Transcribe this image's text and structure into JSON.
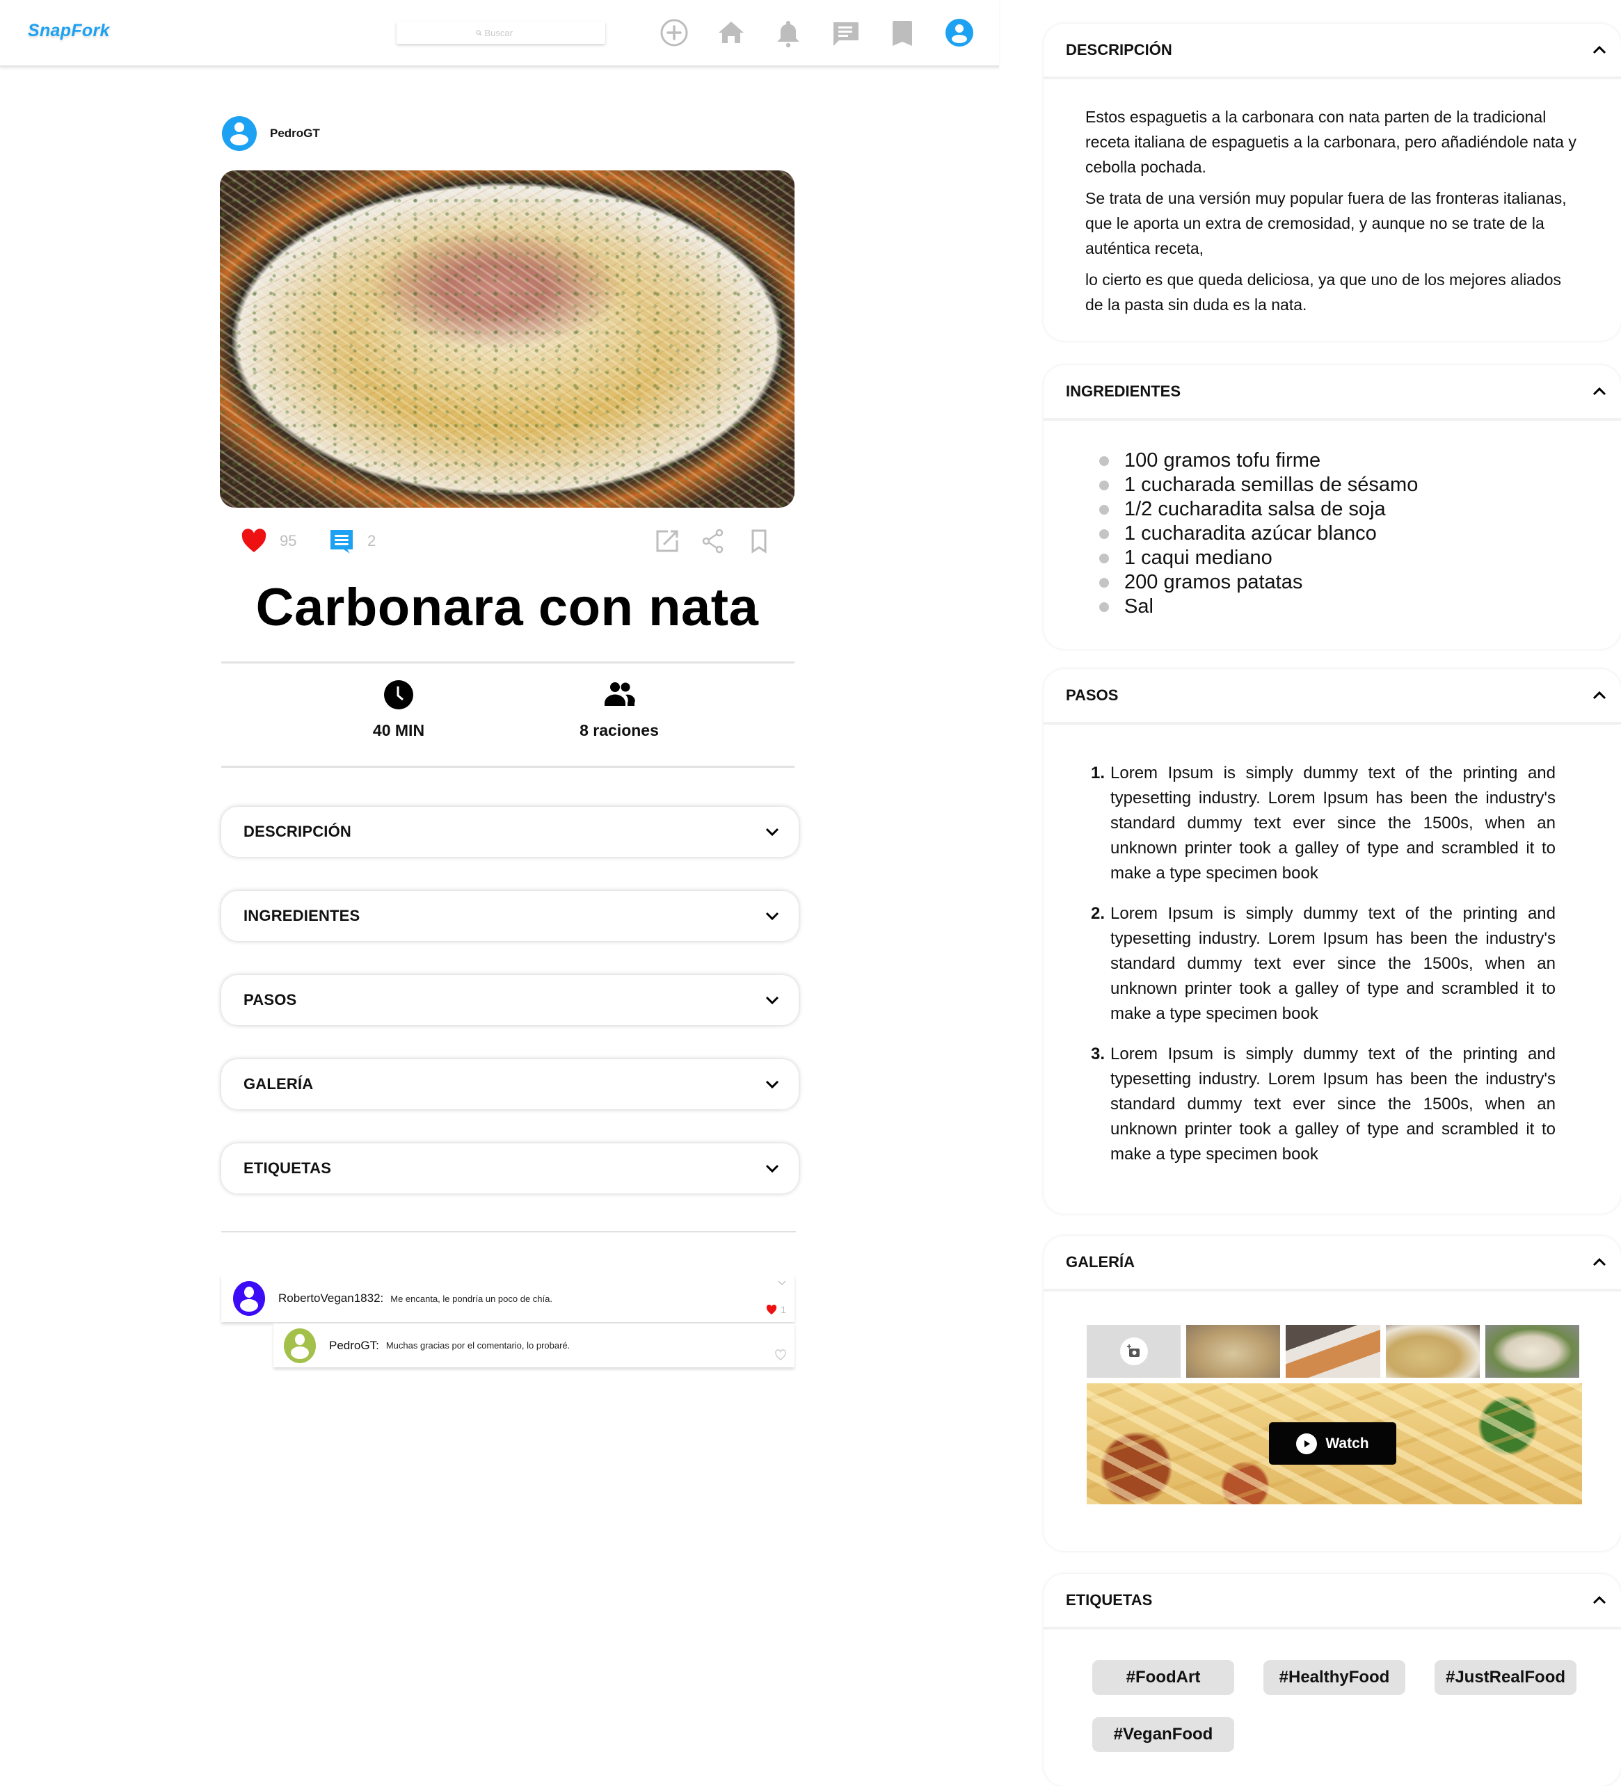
{
  "header": {
    "logo": "SnapFork",
    "search_placeholder": "Buscar",
    "nav_icons": [
      "add-icon",
      "home-icon",
      "bell-icon",
      "messages-icon",
      "bookmark-icon",
      "profile-icon"
    ],
    "accent_color": "#1da1f2"
  },
  "post": {
    "author": "PedroGT",
    "likes": "95",
    "comments": "2",
    "title": "Carbonara con nata",
    "time": "40 MIN",
    "servings": "8 raciones"
  },
  "accordion": [
    {
      "label": "DESCRIPCIÓN"
    },
    {
      "label": "INGREDIENTES"
    },
    {
      "label": "PASOS"
    },
    {
      "label": "GALERÍA"
    },
    {
      "label": "ETIQUETAS"
    }
  ],
  "comments": [
    {
      "user": "RobertoVegan1832:",
      "text": "Me encanta, le pondría un poco de chía.",
      "likes": "1",
      "liked": true,
      "avatar_color": "#3b0cf5"
    },
    {
      "user": "PedroGT:",
      "text": "Muchas gracias por el comentario, lo probaré.",
      "likes": "",
      "liked": false,
      "avatar_color": "#a3c14a"
    }
  ],
  "panel": {
    "description": {
      "title": "DESCRIPCIÓN",
      "paragraphs": [
        "Estos espaguetis a la carbonara con nata parten de la tradicional receta italiana de espaguetis a la carbonara, pero añadiéndole nata y cebolla pochada.",
        "Se trata de una versión muy popular fuera de las fronteras italianas, que le aporta un extra de cremosidad, y aunque no se trate de la auténtica receta,",
        "lo cierto es que queda deliciosa, ya que uno de los mejores aliados de la pasta sin duda es la nata."
      ]
    },
    "ingredients": {
      "title": "INGREDIENTES",
      "items": [
        "100 gramos tofu firme",
        "1 cucharada semillas de sésamo",
        "1/2 cucharadita salsa de soja",
        "1 cucharadita azúcar blanco",
        "1 caqui mediano",
        "200 gramos patatas",
        "Sal"
      ]
    },
    "steps": {
      "title": "PASOS",
      "items": [
        {
          "num": "1.",
          "text": "Lorem Ipsum is simply dummy text of the printing and typesetting industry. Lorem Ipsum has been the industry's standard dummy text ever since the 1500s, when an unknown printer took a galley of type and scrambled it to make a type specimen book"
        },
        {
          "num": "2.",
          "text": "Lorem Ipsum is simply dummy text of the printing and typesetting industry. Lorem Ipsum has been the industry's standard dummy text ever since the 1500s, when an unknown printer took a galley of type and scrambled it to make a type specimen book"
        },
        {
          "num": "3.",
          "text": "Lorem Ipsum is simply dummy text of the printing and typesetting industry. Lorem Ipsum has been the industry's standard dummy text ever since the 1500s, when an unknown printer took a galley of type and scrambled it to make a type specimen book"
        }
      ]
    },
    "gallery": {
      "title": "GALERÍA",
      "add_photo_icon": "add-photo-icon",
      "watch_label": "Watch"
    },
    "tags": {
      "title": "ETIQUETAS",
      "items": [
        "#FoodArt",
        "#HealthyFood",
        "#JustRealFood",
        "#VeganFood"
      ]
    }
  }
}
